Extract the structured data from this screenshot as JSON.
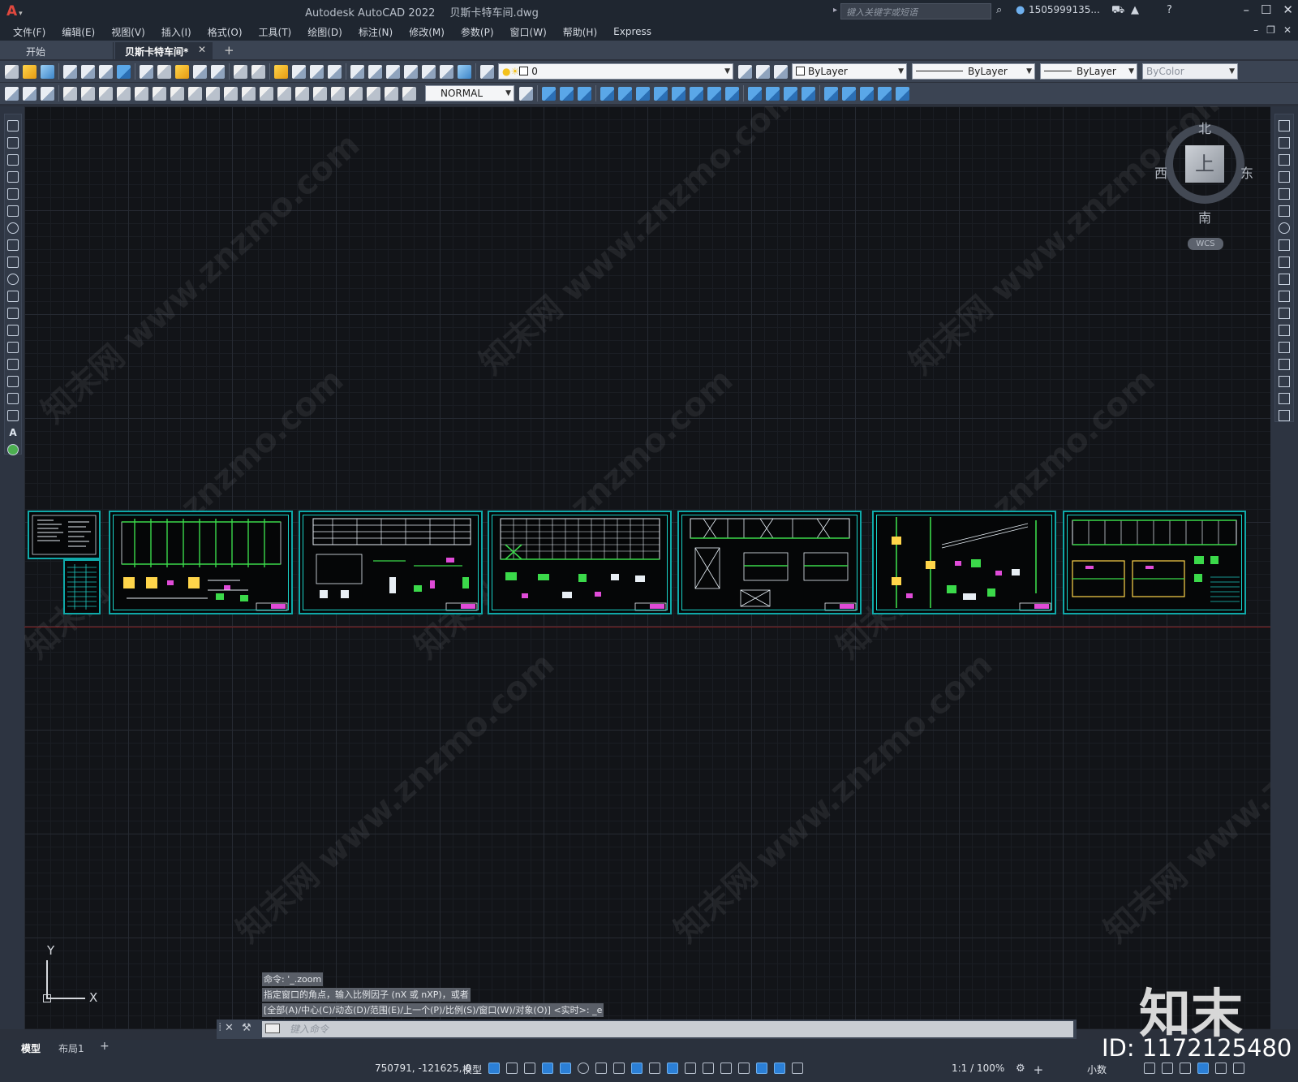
{
  "titlebar": {
    "app": "Autodesk AutoCAD 2022",
    "file": "贝斯卡特车间.dwg",
    "search_placeholder": "键入关键字或短语",
    "user": "1505999135..."
  },
  "menubar": {
    "items": [
      "文件(F)",
      "编辑(E)",
      "视图(V)",
      "插入(I)",
      "格式(O)",
      "工具(T)",
      "绘图(D)",
      "标注(N)",
      "修改(M)",
      "参数(P)",
      "窗口(W)",
      "帮助(H)",
      "Express"
    ]
  },
  "tabs": {
    "start": "开始",
    "document": "贝斯卡特车间*",
    "close": "✕",
    "add": "+"
  },
  "toolbar": {
    "layer": "0",
    "color": "ByLayer",
    "linetype": "ByLayer",
    "lineweight": "ByLayer",
    "plotstyle": "ByColor",
    "dimstyle": "NORMAL"
  },
  "viewcube": {
    "north": "北",
    "south": "南",
    "east": "东",
    "west": "西",
    "face": "上",
    "wcs": "WCS"
  },
  "ucs": {
    "x": "X",
    "y": "Y"
  },
  "command": {
    "history": [
      "命令: '_.zoom",
      "指定窗口的角点，输入比例因子 (nX 或 nXP)，或者",
      "[全部(A)/中心(C)/动态(D)/范围(E)/上一个(P)/比例(S)/窗口(W)/对象(O)] <实时>: _e"
    ],
    "placeholder": "键入命令"
  },
  "layout_tabs": {
    "model": "模型",
    "layout1": "布局1",
    "add": "+"
  },
  "status": {
    "coords": "750791, -121625, 0",
    "space": "模型",
    "scale": "1:1 / 100%",
    "units": "小数"
  },
  "watermark": {
    "logo": "知末",
    "id": "ID: 1172125480",
    "diagonal": "知末网 www.znzmo.com"
  },
  "colors": {
    "sheet_border": "#0fa9a9",
    "accent_blue": "#2b7fd6",
    "canvas": "#121418"
  }
}
